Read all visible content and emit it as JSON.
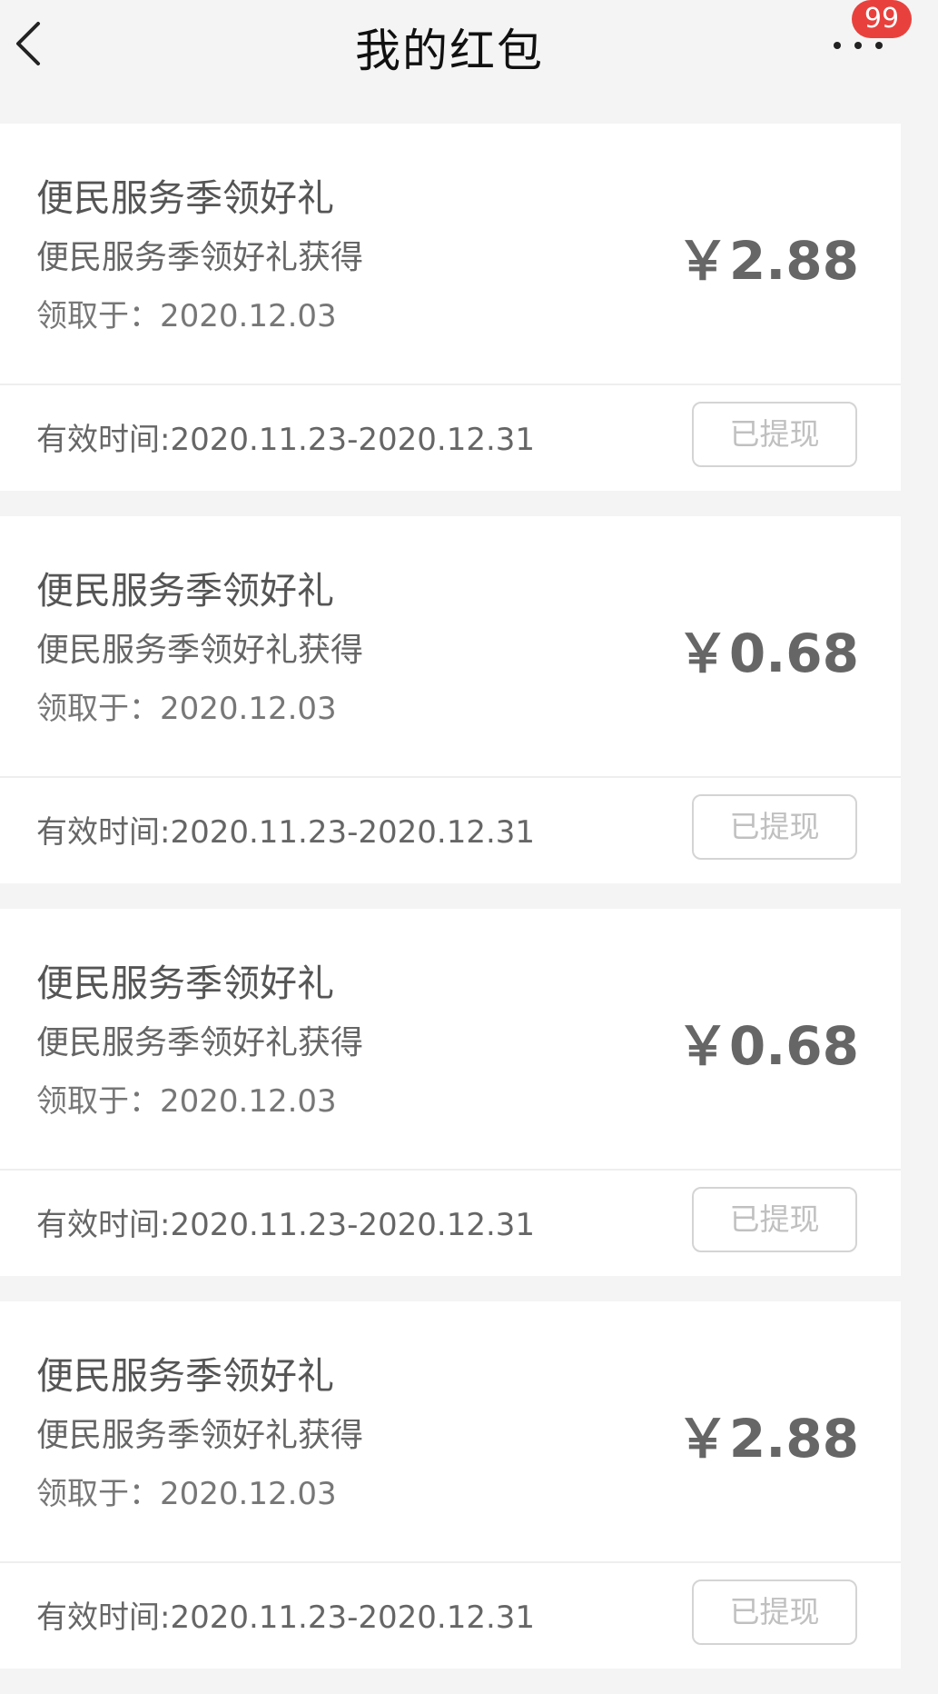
{
  "header": {
    "title": "我的红包",
    "badge_count": "99"
  },
  "cards": [
    {
      "title": "便民服务季领好礼",
      "subtitle": "便民服务季领好礼获得",
      "received": "领取于：2020.12.03",
      "amount": "￥2.88",
      "validity": "有效时间:2020.11.23-2020.12.31",
      "status": "已提现"
    },
    {
      "title": "便民服务季领好礼",
      "subtitle": "便民服务季领好礼获得",
      "received": "领取于：2020.12.03",
      "amount": "￥0.68",
      "validity": "有效时间:2020.11.23-2020.12.31",
      "status": "已提现"
    },
    {
      "title": "便民服务季领好礼",
      "subtitle": "便民服务季领好礼获得",
      "received": "领取于：2020.12.03",
      "amount": "￥0.68",
      "validity": "有效时间:2020.11.23-2020.12.31",
      "status": "已提现"
    },
    {
      "title": "便民服务季领好礼",
      "subtitle": "便民服务季领好礼获得",
      "received": "领取于：2020.12.03",
      "amount": "￥2.88",
      "validity": "有效时间:2020.11.23-2020.12.31",
      "status": "已提现"
    }
  ],
  "colors": {
    "badge": "#e8413d",
    "background": "#f4f4f4",
    "card": "#ffffff"
  },
  "icons": {
    "back": "chevron-left-icon",
    "more": "more-dots-icon"
  }
}
